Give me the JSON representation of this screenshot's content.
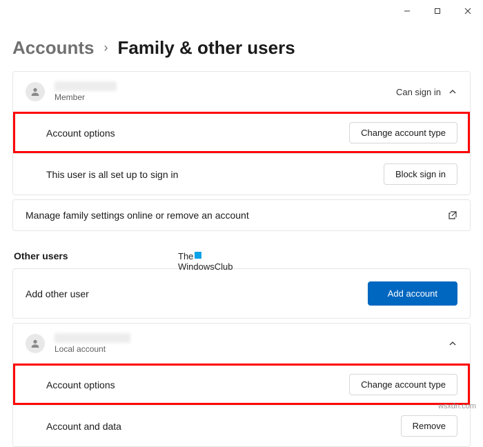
{
  "titlebar": {
    "min": "—",
    "max": "□",
    "close": "✕"
  },
  "breadcrumb": {
    "parent": "Accounts",
    "sep": "›",
    "current": "Family & other users"
  },
  "family": {
    "user1": {
      "role": "Member",
      "status": "Can sign in",
      "account_options_label": "Account options",
      "change_type_btn": "Change account type",
      "signin_msg": "This user is all set up to sign in",
      "block_btn": "Block sign in"
    },
    "manage_link": "Manage family settings online or remove an account"
  },
  "other": {
    "section_title": "Other users",
    "add_label": "Add other user",
    "add_btn": "Add account",
    "user1": {
      "role": "Local account",
      "account_options_label": "Account options",
      "change_type_btn": "Change account type",
      "data_label": "Account and data",
      "remove_btn": "Remove"
    }
  },
  "watermark": {
    "line1": "The",
    "line2": "WindowsClub"
  },
  "sitemark": "wsxdn.com"
}
